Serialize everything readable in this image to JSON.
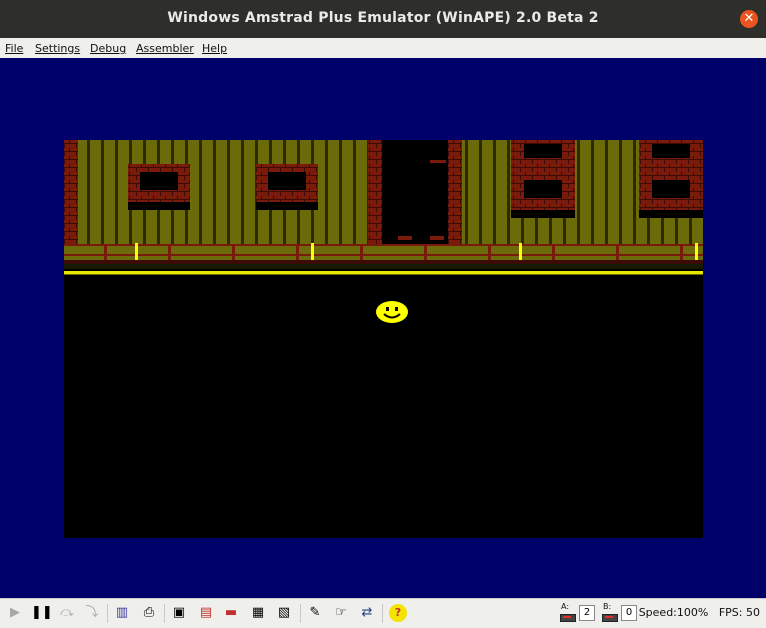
{
  "window": {
    "title": "Windows Amstrad Plus Emulator (WinAPE) 2.0 Beta 2"
  },
  "menu": [
    "File",
    "Settings",
    "Debug",
    "Assembler",
    "Help"
  ],
  "status": {
    "drive_a_label": "A:",
    "drive_a_count": "2",
    "drive_b_label": "B:",
    "drive_b_count": "0",
    "speed": "Speed:100%",
    "fps": "FPS: 50"
  },
  "toolbar_icons": [
    "play-icon",
    "pause-icon",
    "step-icon",
    "step-over-icon",
    "bookshelf-icon",
    "printer-icon",
    "save-icon",
    "floppy-icon",
    "tape-icon",
    "snapshot-icon",
    "snapshot2-icon",
    "joystick-icon",
    "hand-pointer-icon",
    "network-icon",
    "help-icon"
  ],
  "colors": {
    "background": "#00006b",
    "wall": "#6b6b0a",
    "brick": "#7a1a0a",
    "stripe": "#e6e600",
    "face": "#ffff00"
  }
}
